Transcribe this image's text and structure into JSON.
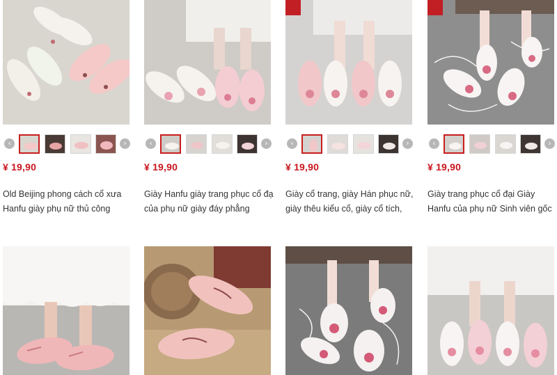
{
  "products": [
    {
      "price": "¥ 19,90",
      "title_line1": "Old Beijing phong cách cổ xưa",
      "title_line2": "Hanfu giày phụ nữ thủ công",
      "palette": {
        "bg": "#d9d6d0",
        "shoe": "#f4c9c8",
        "accent": "#e39aa0"
      }
    },
    {
      "price": "¥ 19,90",
      "title_line1": "Giày Hanfu giày trang phục cổ đại",
      "title_line2": "của phụ nữ giày đáy phẳng",
      "palette": {
        "bg": "#cfcbc6",
        "shoe": "#f6f2ee",
        "accent": "#e9a3b0"
      }
    },
    {
      "price": "¥ 19,90",
      "title_line1": "Giày cổ trang, giày Hán phục nữ,",
      "title_line2": "giày thêu kiểu cổ, giày cổ tích,",
      "palette": {
        "bg": "#d5d3d1",
        "shoe": "#f1c7ca",
        "accent": "#dd8797"
      }
    },
    {
      "price": "¥ 19,90",
      "title_line1": "Giày trang phục cổ đại Giày",
      "title_line2": "Hanfu của phụ nữ Sinh viên gốc",
      "palette": {
        "bg": "#8e8e8e",
        "shoe": "#f7f4f3",
        "accent": "#d86a83"
      }
    },
    {
      "palette": {
        "bg": "#b9b7b3",
        "shoe": "#f0b7b9",
        "accent": "#c97b86"
      }
    },
    {
      "palette": {
        "bg": "#b79a73",
        "shoe": "#f1c2bd",
        "accent": "#8e4a53"
      }
    },
    {
      "palette": {
        "bg": "#7b7b7b",
        "shoe": "#f4f1f0",
        "accent": "#d45a77"
      }
    },
    {
      "palette": {
        "bg": "#c9c7c4",
        "shoe": "#f7f4f3",
        "accent": "#e58da1"
      }
    }
  ],
  "icons": {
    "prev": "‹",
    "next": "›"
  }
}
